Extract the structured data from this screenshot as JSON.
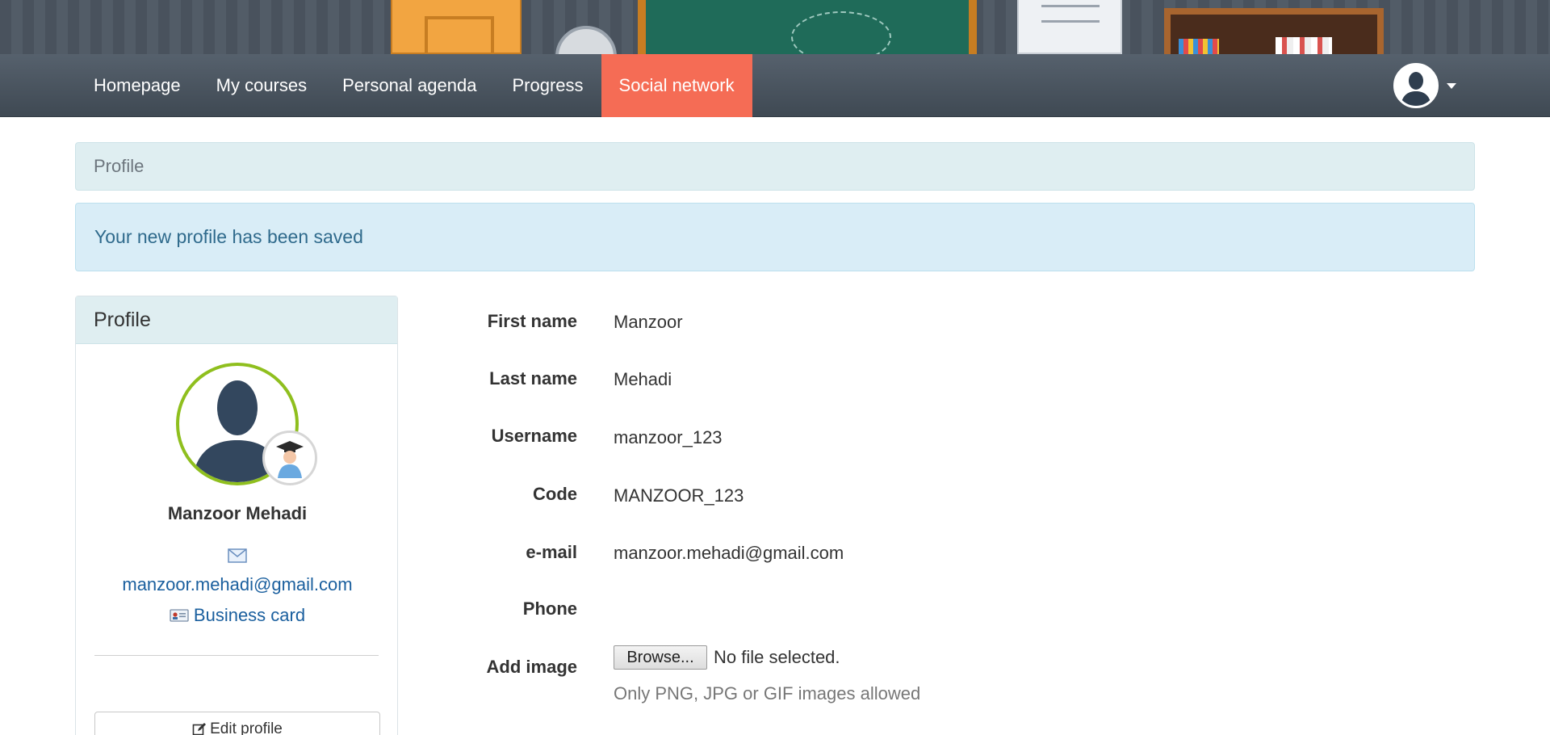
{
  "navbar": {
    "items": [
      {
        "label": "Homepage"
      },
      {
        "label": "My courses"
      },
      {
        "label": "Personal agenda"
      },
      {
        "label": "Progress"
      },
      {
        "label": "Social network",
        "active": true
      }
    ],
    "active_color": "#f56c55"
  },
  "breadcrumb": {
    "current": "Profile"
  },
  "alert": {
    "message": "Your new profile has been saved"
  },
  "sidebar": {
    "title": "Profile",
    "full_name": "Manzoor Mehadi",
    "email": "manzoor.mehadi@gmail.com",
    "business_card_label": "Business card",
    "edit_profile_label": "Edit profile",
    "avatar_ring_color": "#8fbf1e"
  },
  "form": {
    "first_name": {
      "label": "First name",
      "value": "Manzoor"
    },
    "last_name": {
      "label": "Last name",
      "value": "Mehadi"
    },
    "username": {
      "label": "Username",
      "value": "manzoor_123"
    },
    "code": {
      "label": "Code",
      "value": "MANZOOR_123"
    },
    "email": {
      "label": "e-mail",
      "value": "manzoor.mehadi@gmail.com"
    },
    "phone": {
      "label": "Phone",
      "value": ""
    },
    "add_image": {
      "label": "Add image",
      "browse_label": "Browse...",
      "file_status": "No file selected.",
      "help": "Only PNG, JPG or GIF images allowed"
    }
  }
}
